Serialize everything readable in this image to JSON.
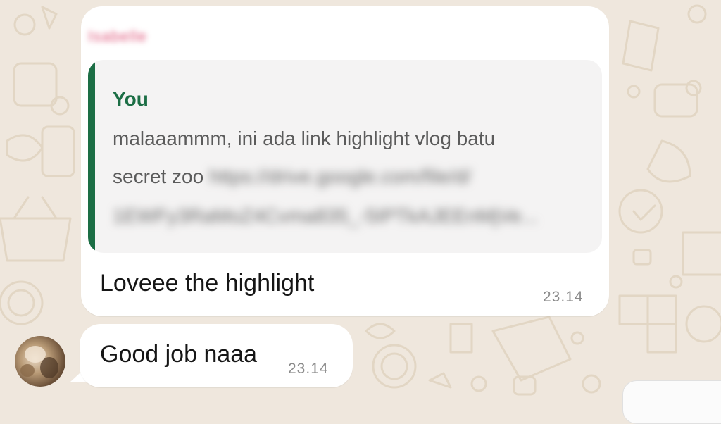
{
  "chat": {
    "background_color": "#efe7dd",
    "messages": [
      {
        "sender_name": "Isabelle",
        "quote": {
          "author": "You",
          "line1": "malaaammm, ini ada link highlight vlog batu",
          "line2_prefix": "secret zoo",
          "link_part1": "https://drive.google.com/file/d/",
          "link_part2": "1EWFy3RaMoZ4Cvma835_-5IPTkAJEEnMjVe..."
        },
        "text": "Loveee the highlight",
        "time": "23.14"
      },
      {
        "text": "Good job naaa",
        "time": "23.14"
      }
    ]
  }
}
